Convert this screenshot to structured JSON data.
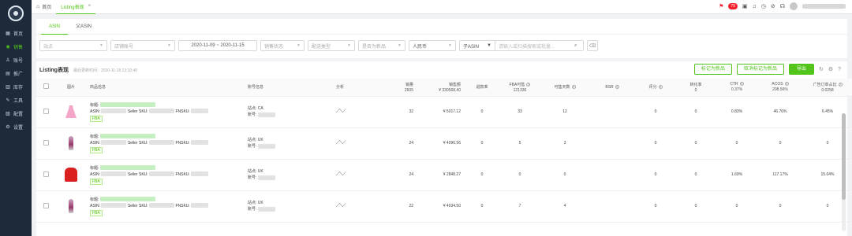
{
  "sidebar": {
    "items": [
      {
        "icon": "dashboard-icon",
        "glyph": "▦",
        "label": "首页"
      },
      {
        "icon": "sales-icon",
        "glyph": "◉",
        "label": "销售"
      },
      {
        "icon": "account-icon",
        "glyph": "♙",
        "label": "账号"
      },
      {
        "icon": "ads-icon",
        "glyph": "▤",
        "label": "推广"
      },
      {
        "icon": "inventory-icon",
        "glyph": "▥",
        "label": "库存"
      },
      {
        "icon": "tools-icon",
        "glyph": "✎",
        "label": "工具"
      },
      {
        "icon": "data-icon",
        "glyph": "▧",
        "label": "配置"
      },
      {
        "icon": "settings-icon",
        "glyph": "⚙",
        "label": "设置"
      }
    ],
    "active_index": 1
  },
  "topbar": {
    "tabs": [
      {
        "label": "首页",
        "home_glyph": "⌂"
      },
      {
        "label": "Listing表现",
        "close_glyph": "×"
      }
    ],
    "notification_count": "79"
  },
  "filters": {
    "sub_tabs": [
      "ASIN",
      "父ASIN"
    ],
    "site_placeholder": "站点",
    "store_placeholder": "店铺账号",
    "date_range": "2020-11-09 ~ 2020-11-15",
    "sale_status_placeholder": "销售状态",
    "delivery_placeholder": "配送类型",
    "new_placeholder": "是否为新品",
    "currency": "人民币",
    "search_type": "子ASIN",
    "search_placeholder": "请输入或扫描搜索或批量...",
    "trash_glyph": "🗑"
  },
  "table": {
    "title": "Listing表现",
    "updated_text": "最后更新时间：2020-11-18 13:10:40",
    "buttons": {
      "mark_new": "标记为新品",
      "unmark_new": "取消标记为新品",
      "export": "导出"
    },
    "columns": {
      "image": "图片",
      "product_info": "商品信息",
      "account_info": "账号信息",
      "analysis": "分析",
      "sales": "销量",
      "sales_total": "2605",
      "revenue": "销售额",
      "revenue_total": "¥ 330568.40",
      "return_rate": "退款率",
      "fba_stock": "FBA可售",
      "fba_stock_total": "121336",
      "sellable_days": "可售天数",
      "bsr": "BSR",
      "rating": "评分",
      "conversion": "转化率",
      "conversion_total": "0",
      "ctr": "CTR",
      "ctr_total": "0.37%",
      "acos": "ACOS",
      "acos_total": "208.56%",
      "ad_order_ratio": "广告订单占比",
      "ad_order_ratio_total": "0.0258"
    },
    "labels": {
      "title": "标题:",
      "asin": "ASIN:",
      "seller_sku": "Seller SKU:",
      "fnsku": "FNSKU:",
      "site": "站点:",
      "account": "账号:",
      "fba": "FBA"
    },
    "rows": [
      {
        "image": "pink dress",
        "site": "CA",
        "sales": "32",
        "revenue": "¥ 5017.12",
        "return_rate": "0",
        "fba_stock": "33",
        "sellable_days": "12",
        "rating": "0",
        "conversion": "0",
        "ctr": "0.83%",
        "acos": "46.76%",
        "ad_order_ratio": "6.45%"
      },
      {
        "image": "figure",
        "site": "UK",
        "sales": "24",
        "revenue": "¥ 4096.56",
        "return_rate": "0",
        "fba_stock": "5",
        "sellable_days": "3",
        "rating": "0",
        "conversion": "0",
        "ctr": "0",
        "acos": "0",
        "ad_order_ratio": "0"
      },
      {
        "image": "red hoodie",
        "site": "UK",
        "sales": "24",
        "revenue": "¥ 2848.27",
        "return_rate": "0",
        "fba_stock": "0",
        "sellable_days": "0",
        "rating": "0",
        "conversion": "0",
        "ctr": "1.69%",
        "acos": "117.17%",
        "ad_order_ratio": "15.04%"
      },
      {
        "image": "figure",
        "site": "UK",
        "sales": "22",
        "revenue": "¥ 4034.50",
        "return_rate": "0",
        "fba_stock": "7",
        "sellable_days": "4",
        "rating": "0",
        "conversion": "0",
        "ctr": "0",
        "acos": "0",
        "ad_order_ratio": "0"
      }
    ]
  },
  "colors": {
    "accent": "#52c41a",
    "sidebar_bg": "#1e2a3a",
    "badge": "#f5222d"
  }
}
